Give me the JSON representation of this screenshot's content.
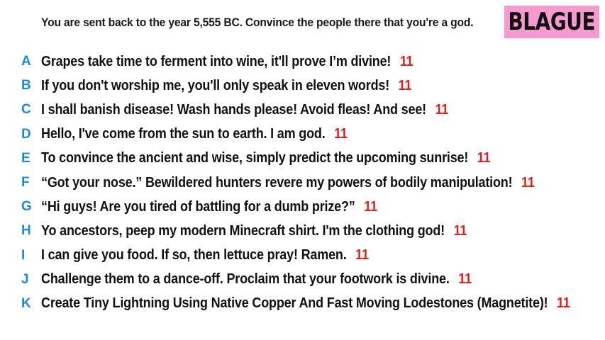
{
  "prompt": "You are sent back to the year 5,555 BC. Convince the people there that you're a god.",
  "logo": "BLAGUE",
  "colors": {
    "letter": "#1e88e5",
    "score": "#e0201b",
    "logo_bg": "#f79ad0"
  },
  "answers": [
    {
      "letter": "A",
      "text": "Grapes take time to ferment into wine, it'll prove I’m divine!",
      "score": "11"
    },
    {
      "letter": "B",
      "text": "If you don't worship me, you'll only speak in eleven words!",
      "score": "11"
    },
    {
      "letter": "C",
      "text": "I shall banish disease! Wash hands please! Avoid fleas! And see!",
      "score": "11"
    },
    {
      "letter": "D",
      "text": "Hello, I've come from the sun to earth. I am god.",
      "score": "11"
    },
    {
      "letter": "E",
      "text": "To convince the ancient and wise, simply predict the upcoming sunrise!",
      "score": "11"
    },
    {
      "letter": "F",
      "text": "“Got your nose.” Bewildered hunters revere my powers of bodily manipulation!",
      "score": "11"
    },
    {
      "letter": "G",
      "text": "“Hi guys! Are you tired of battling for a dumb prize?”",
      "score": "11"
    },
    {
      "letter": "H",
      "text": "Yo ancestors, peep my modern Minecraft shirt. I'm the clothing god!",
      "score": "11"
    },
    {
      "letter": "I",
      "text": "I can give you food. If so, then lettuce pray! Ramen.",
      "score": "11"
    },
    {
      "letter": "J",
      "text": "Challenge them to a dance-off. Proclaim that your footwork is divine.",
      "score": "11"
    },
    {
      "letter": "K",
      "text": "Create Tiny Lightning Using Native Copper And Fast Moving Lodestones (Magnetite)!",
      "score": "11"
    }
  ]
}
